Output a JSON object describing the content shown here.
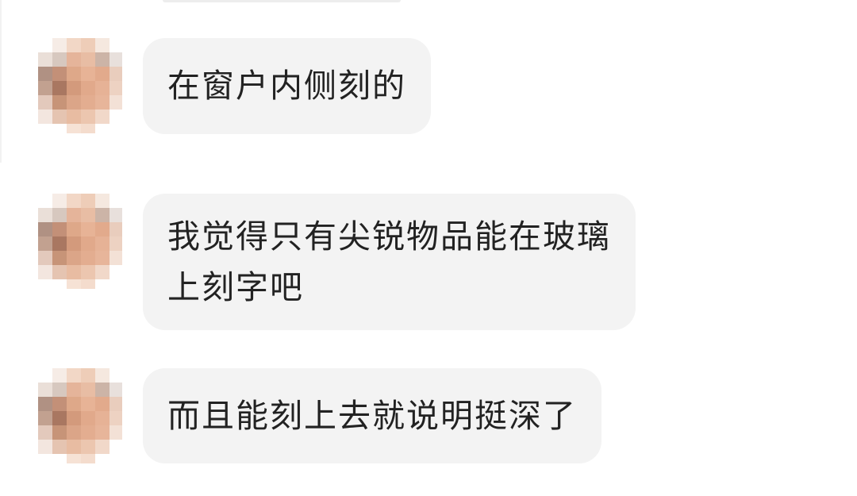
{
  "chat": {
    "messages": [
      {
        "sender_avatar": "pixelated-avatar",
        "lines": [
          "在窗户内侧刻的"
        ]
      },
      {
        "sender_avatar": "pixelated-avatar",
        "lines": [
          "我觉得只有尖锐物品能在玻璃",
          "上刻字吧"
        ]
      },
      {
        "sender_avatar": "pixelated-avatar",
        "lines": [
          "而且能刻上去就说明挺深了"
        ]
      }
    ]
  },
  "colors": {
    "bubble_background": "#f3f3f3",
    "text": "#222222",
    "page_background": "#ffffff"
  }
}
